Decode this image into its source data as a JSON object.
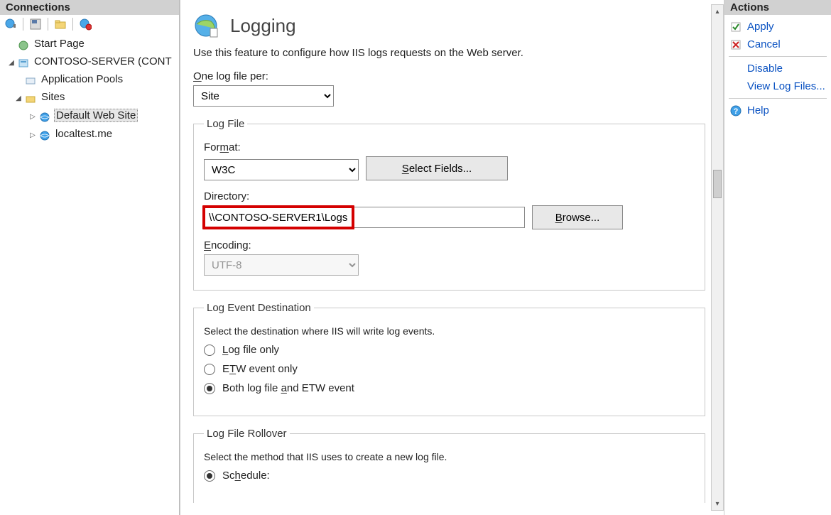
{
  "left": {
    "header": "Connections",
    "tree": {
      "start_page": "Start Page",
      "server": "CONTOSO-SERVER (CONT",
      "app_pools": "Application Pools",
      "sites": "Sites",
      "site1": "Default Web Site",
      "site2": "localtest.me"
    }
  },
  "center": {
    "title": "Logging",
    "description": "Use this feature to configure how IIS logs requests on the Web server.",
    "one_per_label": "One log file per:",
    "one_per_value": "Site",
    "log_file_legend": "Log File",
    "format_label": "Format:",
    "format_value": "W3C",
    "select_fields_btn": "Select Fields...",
    "directory_label": "Directory:",
    "directory_value": "\\\\CONTOSO-SERVER1\\Logs",
    "browse_btn": "Browse...",
    "encoding_label": "Encoding:",
    "encoding_value": "UTF-8",
    "dest_legend": "Log Event Destination",
    "dest_desc": "Select the destination where IIS will write log events.",
    "dest_opt1": "Log file only",
    "dest_opt2": "ETW event only",
    "dest_opt3": "Both log file and ETW event",
    "rollover_legend": "Log File Rollover",
    "rollover_desc": "Select the method that IIS uses to create a new log file.",
    "rollover_opt1": "Schedule:"
  },
  "right": {
    "header": "Actions",
    "apply": "Apply",
    "cancel": "Cancel",
    "disable": "Disable",
    "view_logs": "View Log Files...",
    "help": "Help"
  }
}
